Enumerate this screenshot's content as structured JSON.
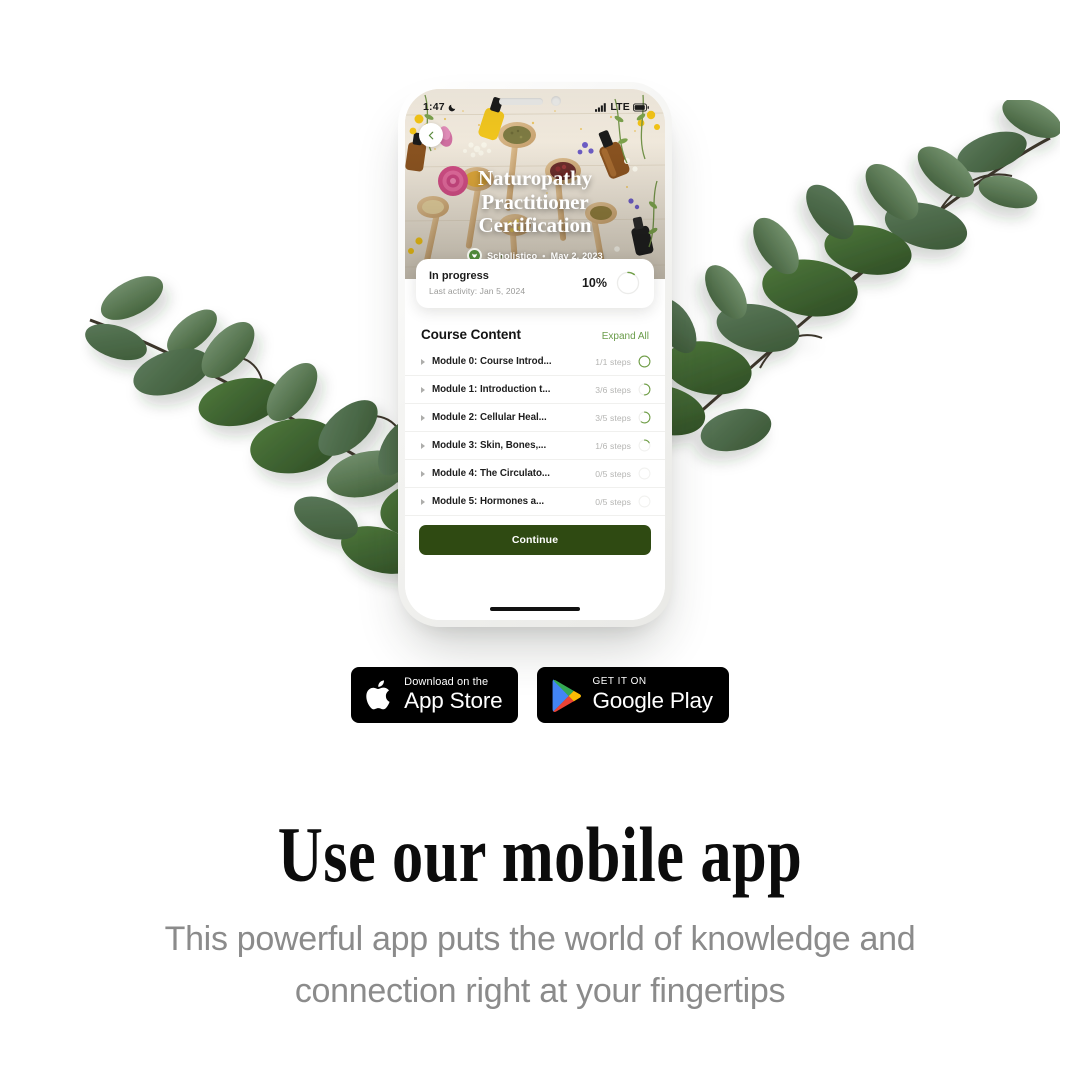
{
  "background_color": "#ffffff",
  "phone": {
    "status_bar": {
      "time": "1:47",
      "moon_icon": "crescent-moon-icon",
      "signal_icon": "cellular-signal-icon",
      "network": "LTE",
      "battery_icon": "battery-icon"
    },
    "back_button_icon": "chevron-left-icon",
    "hero": {
      "title_line1": "Naturopathy",
      "title_line2": "Practitioner",
      "title_line3": "Certification",
      "brand_logo_icon": "scholistico-logo-icon",
      "brand": "Scholistico",
      "separator": "•",
      "date": "May 2, 2023"
    },
    "progress_card": {
      "status": "In progress",
      "last_activity": "Last activity: Jan 5, 2024",
      "percent_label": "10%",
      "percent_value": 10,
      "ring_track_color": "#e8e8e6",
      "ring_fill_color": "#6f9e46"
    },
    "course_content": {
      "heading": "Course Content",
      "expand_all": "Expand All",
      "expand_all_color": "#6a9c4a",
      "modules": [
        {
          "name": "Module 0: Course Introd...",
          "steps": "1/1 steps",
          "completed": 1,
          "total": 1
        },
        {
          "name": "Module 1: Introduction t...",
          "steps": "3/6 steps",
          "completed": 3,
          "total": 6
        },
        {
          "name": "Module 2: Cellular Heal...",
          "steps": "3/5 steps",
          "completed": 3,
          "total": 5
        },
        {
          "name": "Module 3: Skin, Bones,...",
          "steps": "1/6 steps",
          "completed": 1,
          "total": 6
        },
        {
          "name": "Module 4: The Circulato...",
          "steps": "0/5 steps",
          "completed": 0,
          "total": 5
        },
        {
          "name": "Module 5: Hormones a...",
          "steps": "0/5 steps",
          "completed": 0,
          "total": 5
        }
      ]
    },
    "continue_button": "Continue",
    "continue_color": "#2f4a12"
  },
  "store_badges": {
    "apple": {
      "icon": "apple-logo-icon",
      "small_text": "Download on the",
      "big_text": "App Store"
    },
    "google": {
      "icon": "google-play-logo-icon",
      "small_text": "GET IT ON",
      "big_text": "Google Play"
    }
  },
  "headline": "Use our mobile app",
  "subtitle": "This powerful app puts the world of knowledge and connection right at your fingertips",
  "subtitle_color": "#8b8b8b"
}
